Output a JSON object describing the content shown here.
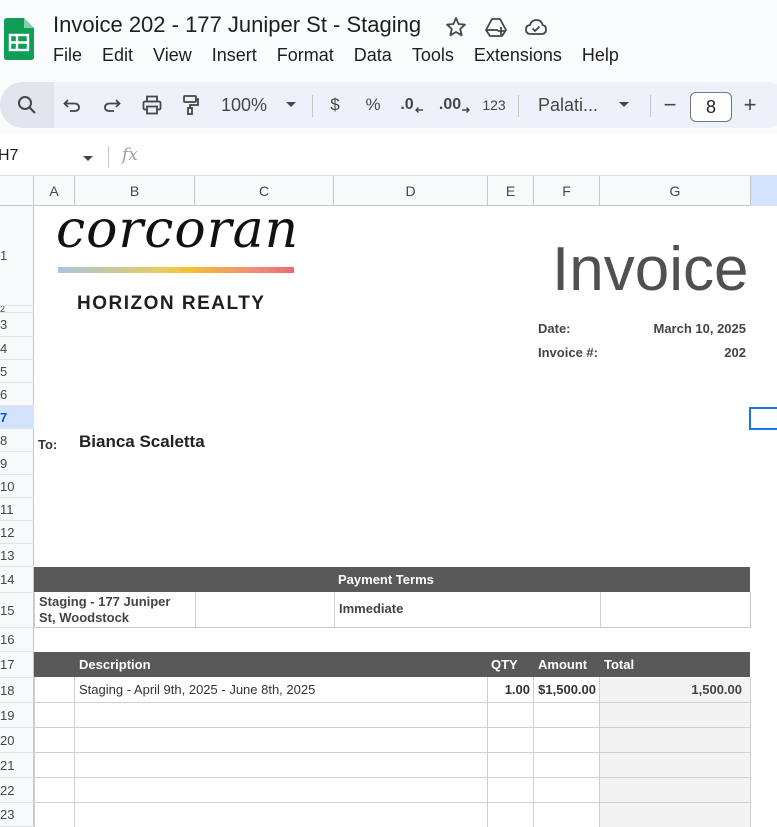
{
  "app": {
    "doc_title": "Invoice 202 - 177 Juniper St - Staging",
    "icons": [
      "star-icon",
      "move-to-drive-icon",
      "cloud-saved-icon"
    ],
    "brand_color": "#0f9d58"
  },
  "menu": [
    "File",
    "Edit",
    "View",
    "Insert",
    "Format",
    "Data",
    "Tools",
    "Extensions",
    "Help"
  ],
  "toolbar": {
    "zoom": "100%",
    "currency": "$",
    "percent": "%",
    "decimal_decrease": ".0",
    "decimal_increase": ".00",
    "number_format": "123",
    "font": "Palati...",
    "font_size": "8",
    "minus": "−",
    "plus": "+"
  },
  "formula_bar": {
    "name_box": "H7",
    "fx": "fx"
  },
  "columns": [
    "A",
    "B",
    "C",
    "D",
    "E",
    "F",
    "G"
  ],
  "rows": [
    "1",
    "2",
    "3",
    "4",
    "5",
    "6",
    "7",
    "8",
    "9",
    "10",
    "11",
    "12",
    "13",
    "14",
    "15",
    "16",
    "17",
    "18",
    "19",
    "20",
    "21",
    "22",
    "23"
  ],
  "selected_row": "7",
  "invoice": {
    "logo_word": "corcoran",
    "logo_sub": "HORIZON REALTY",
    "title": "Invoice",
    "date_label": "Date:",
    "date_value": "March 10, 2025",
    "number_label": "Invoice #:",
    "number_value": "202",
    "to_label": "To:",
    "to_name": "Bianca Scaletta",
    "payment_terms_header": "Payment Terms",
    "project_line1": "Staging - 177 Juniper",
    "project_line2": "St, Woodstock",
    "payment_terms": "Immediate",
    "headers": {
      "description": "Description",
      "qty": "QTY",
      "amount": "Amount",
      "total": "Total"
    },
    "line_items": [
      {
        "description": "Staging - April 9th, 2025 - June 8th, 2025",
        "qty": "1.00",
        "amount": "$1,500.00",
        "total": "1,500.00"
      }
    ]
  }
}
